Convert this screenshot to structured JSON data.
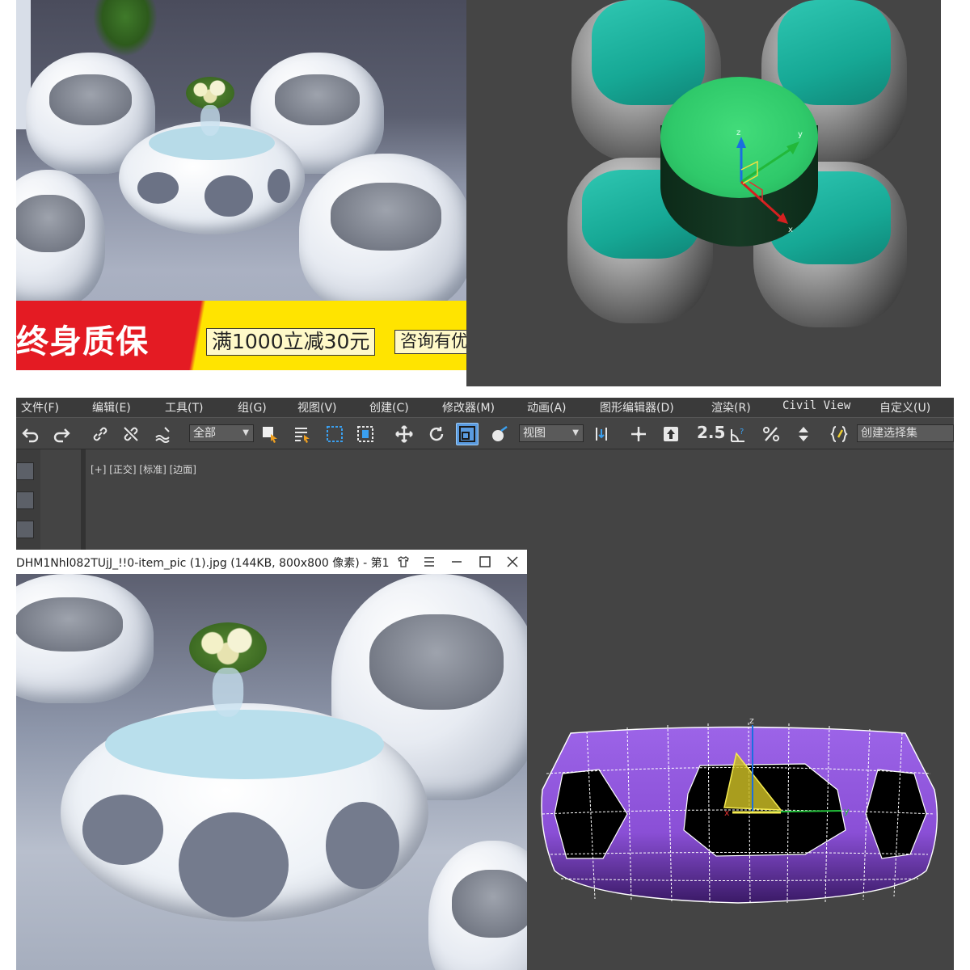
{
  "banner": {
    "main_text": "终身质保",
    "promo_text": "满1000立减30元",
    "consult_text": "咨询有优"
  },
  "menu": [
    {
      "label": "文件(F)"
    },
    {
      "label": "编辑(E)"
    },
    {
      "label": "工具(T)"
    },
    {
      "label": "组(G)"
    },
    {
      "label": "视图(V)"
    },
    {
      "label": "创建(C)"
    },
    {
      "label": "修改器(M)"
    },
    {
      "label": "动画(A)"
    },
    {
      "label": "图形编辑器(D)"
    },
    {
      "label": "渲染(R)"
    },
    {
      "label": "Civil View"
    },
    {
      "label": "自定义(U)"
    }
  ],
  "toolbar": {
    "filter_select": "全部",
    "coord_select": "视图",
    "snap_label": "2.5",
    "selection_set_placeholder": "创建选择集"
  },
  "viewport": {
    "label": "[+] [正交] [标准] [边面]",
    "gizmo_axes": [
      "x",
      "y",
      "z"
    ]
  },
  "image_viewer": {
    "title": "DHM1Nhl082TUjJ_!!0-item_pic (1).jpg (144KB, 800x800 像素) - 第1"
  },
  "colors": {
    "banner_red": "#e41b23",
    "banner_yellow": "#ffe400",
    "cushion_teal": "#1fb8a3",
    "table_green": "#35d070",
    "wire_purple": "#8a4fd6",
    "selected_button": "#5a9be0"
  }
}
